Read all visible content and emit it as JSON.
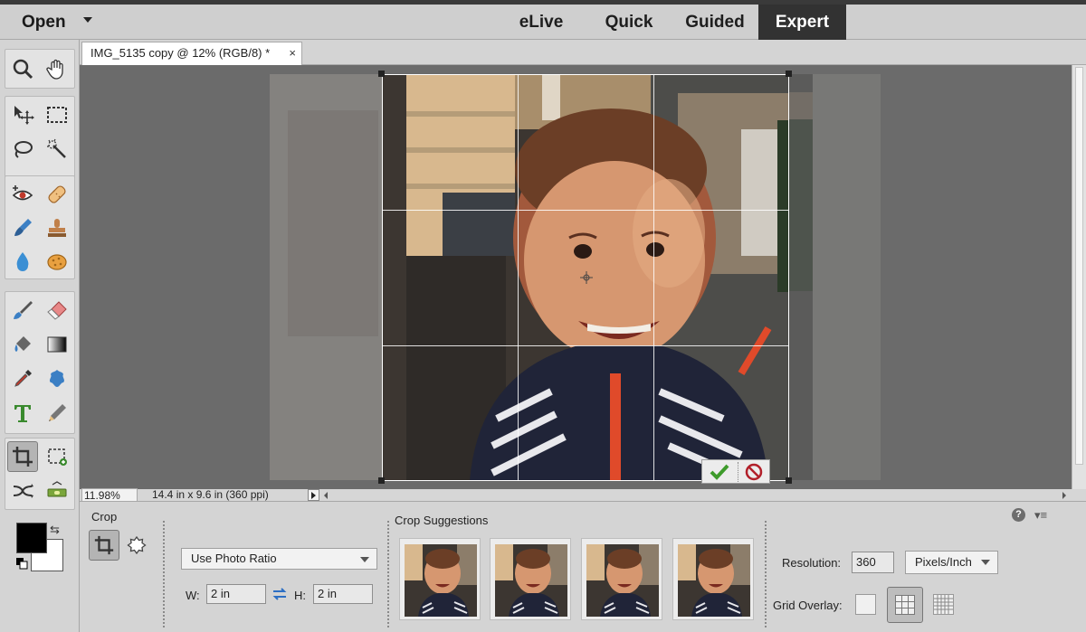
{
  "topbar": {
    "open_label": "Open",
    "tabs": [
      {
        "label": "eLive",
        "active": false
      },
      {
        "label": "Quick",
        "active": false
      },
      {
        "label": "Guided",
        "active": false
      },
      {
        "label": "Expert",
        "active": true
      }
    ]
  },
  "document": {
    "tab_title": "IMG_5135 copy @ 12% (RGB/8) *",
    "close_glyph": "×"
  },
  "tools": [
    "zoom-tool-icon",
    "hand-tool-icon",
    "move-tool-icon",
    "marquee-tool-icon",
    "lasso-tool-icon",
    "quick-selection-tool-icon",
    "red-eye-tool-icon",
    "spot-healing-tool-icon",
    "smart-brush-tool-icon",
    "clone-stamp-tool-icon",
    "blur-tool-icon",
    "sponge-tool-icon",
    "brush-tool-icon",
    "eraser-tool-icon",
    "paint-bucket-tool-icon",
    "gradient-tool-icon",
    "eyedropper-tool-icon",
    "custom-shape-tool-icon",
    "type-tool-icon",
    "pencil-tool-icon",
    "crop-tool-icon",
    "recompose-tool-icon",
    "content-aware-move-tool-icon",
    "straighten-tool-icon"
  ],
  "colors": {
    "foreground": "#000000",
    "background": "#ffffff",
    "active_tab": "#323232",
    "commit_green": "#3e9b2b",
    "cancel_red": "#b2202a"
  },
  "status": {
    "zoom": "11.98%",
    "doc_size": "14.4 in x 9.6 in (360 ppi)"
  },
  "options": {
    "tool_name": "Crop",
    "suggestions_label": "Crop Suggestions",
    "aspect_dropdown": "Use Photo Ratio",
    "w_label": "W:",
    "w_value": "2 in",
    "h_label": "H:",
    "h_value": "2 in",
    "resolution_label": "Resolution:",
    "resolution_value": "360",
    "resolution_unit": "Pixels/Inch",
    "grid_overlay_label": "Grid Overlay:",
    "help_glyph": "?",
    "menu_glyph": "▾≡"
  }
}
